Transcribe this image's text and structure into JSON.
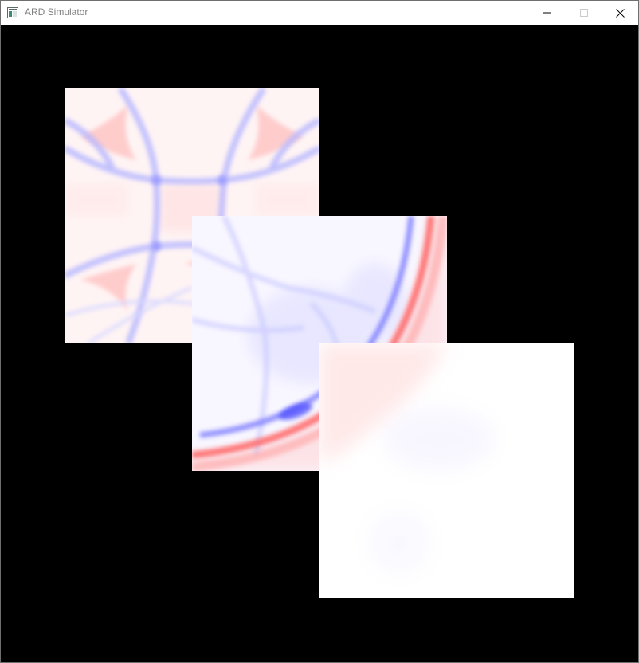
{
  "window": {
    "title": "ARD Simulator",
    "controls": {
      "minimize_icon": "minimize-icon",
      "maximize_icon": "maximize-icon",
      "close_icon": "close-icon"
    }
  },
  "canvas": {
    "background": "#000000",
    "colormap": {
      "positive": "#ff4040",
      "negative": "#4040ff",
      "zero": "#ffffff"
    },
    "partitions": [
      {
        "name": "partition-1"
      },
      {
        "name": "partition-2"
      },
      {
        "name": "partition-3"
      }
    ]
  }
}
